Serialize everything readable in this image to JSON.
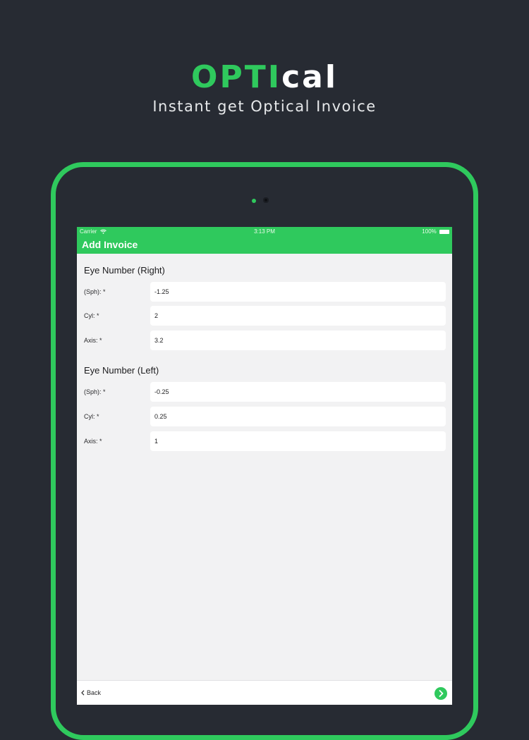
{
  "promo": {
    "logo_part1": "OPTI",
    "logo_part2": "cal",
    "tagline": "Instant get Optical Invoice"
  },
  "status_bar": {
    "carrier": "Carrier",
    "time": "3:13 PM",
    "battery": "100%"
  },
  "nav": {
    "title": "Add Invoice"
  },
  "right_eye": {
    "title": "Eye Number (Right)",
    "fields": [
      {
        "label": "(Sph): *",
        "value": "-1.25"
      },
      {
        "label": "Cyl: *",
        "value": "2"
      },
      {
        "label": "Axis: *",
        "value": "3.2"
      }
    ]
  },
  "left_eye": {
    "title": "Eye Number (Left)",
    "fields": [
      {
        "label": "(Sph): *",
        "value": "-0.25"
      },
      {
        "label": "Cyl: *",
        "value": "0.25"
      },
      {
        "label": "Axis: *",
        "value": "1"
      }
    ]
  },
  "footer": {
    "back_label": "Back"
  },
  "colors": {
    "accent": "#2fc95d",
    "background": "#272b33",
    "screen": "#f2f2f3"
  }
}
